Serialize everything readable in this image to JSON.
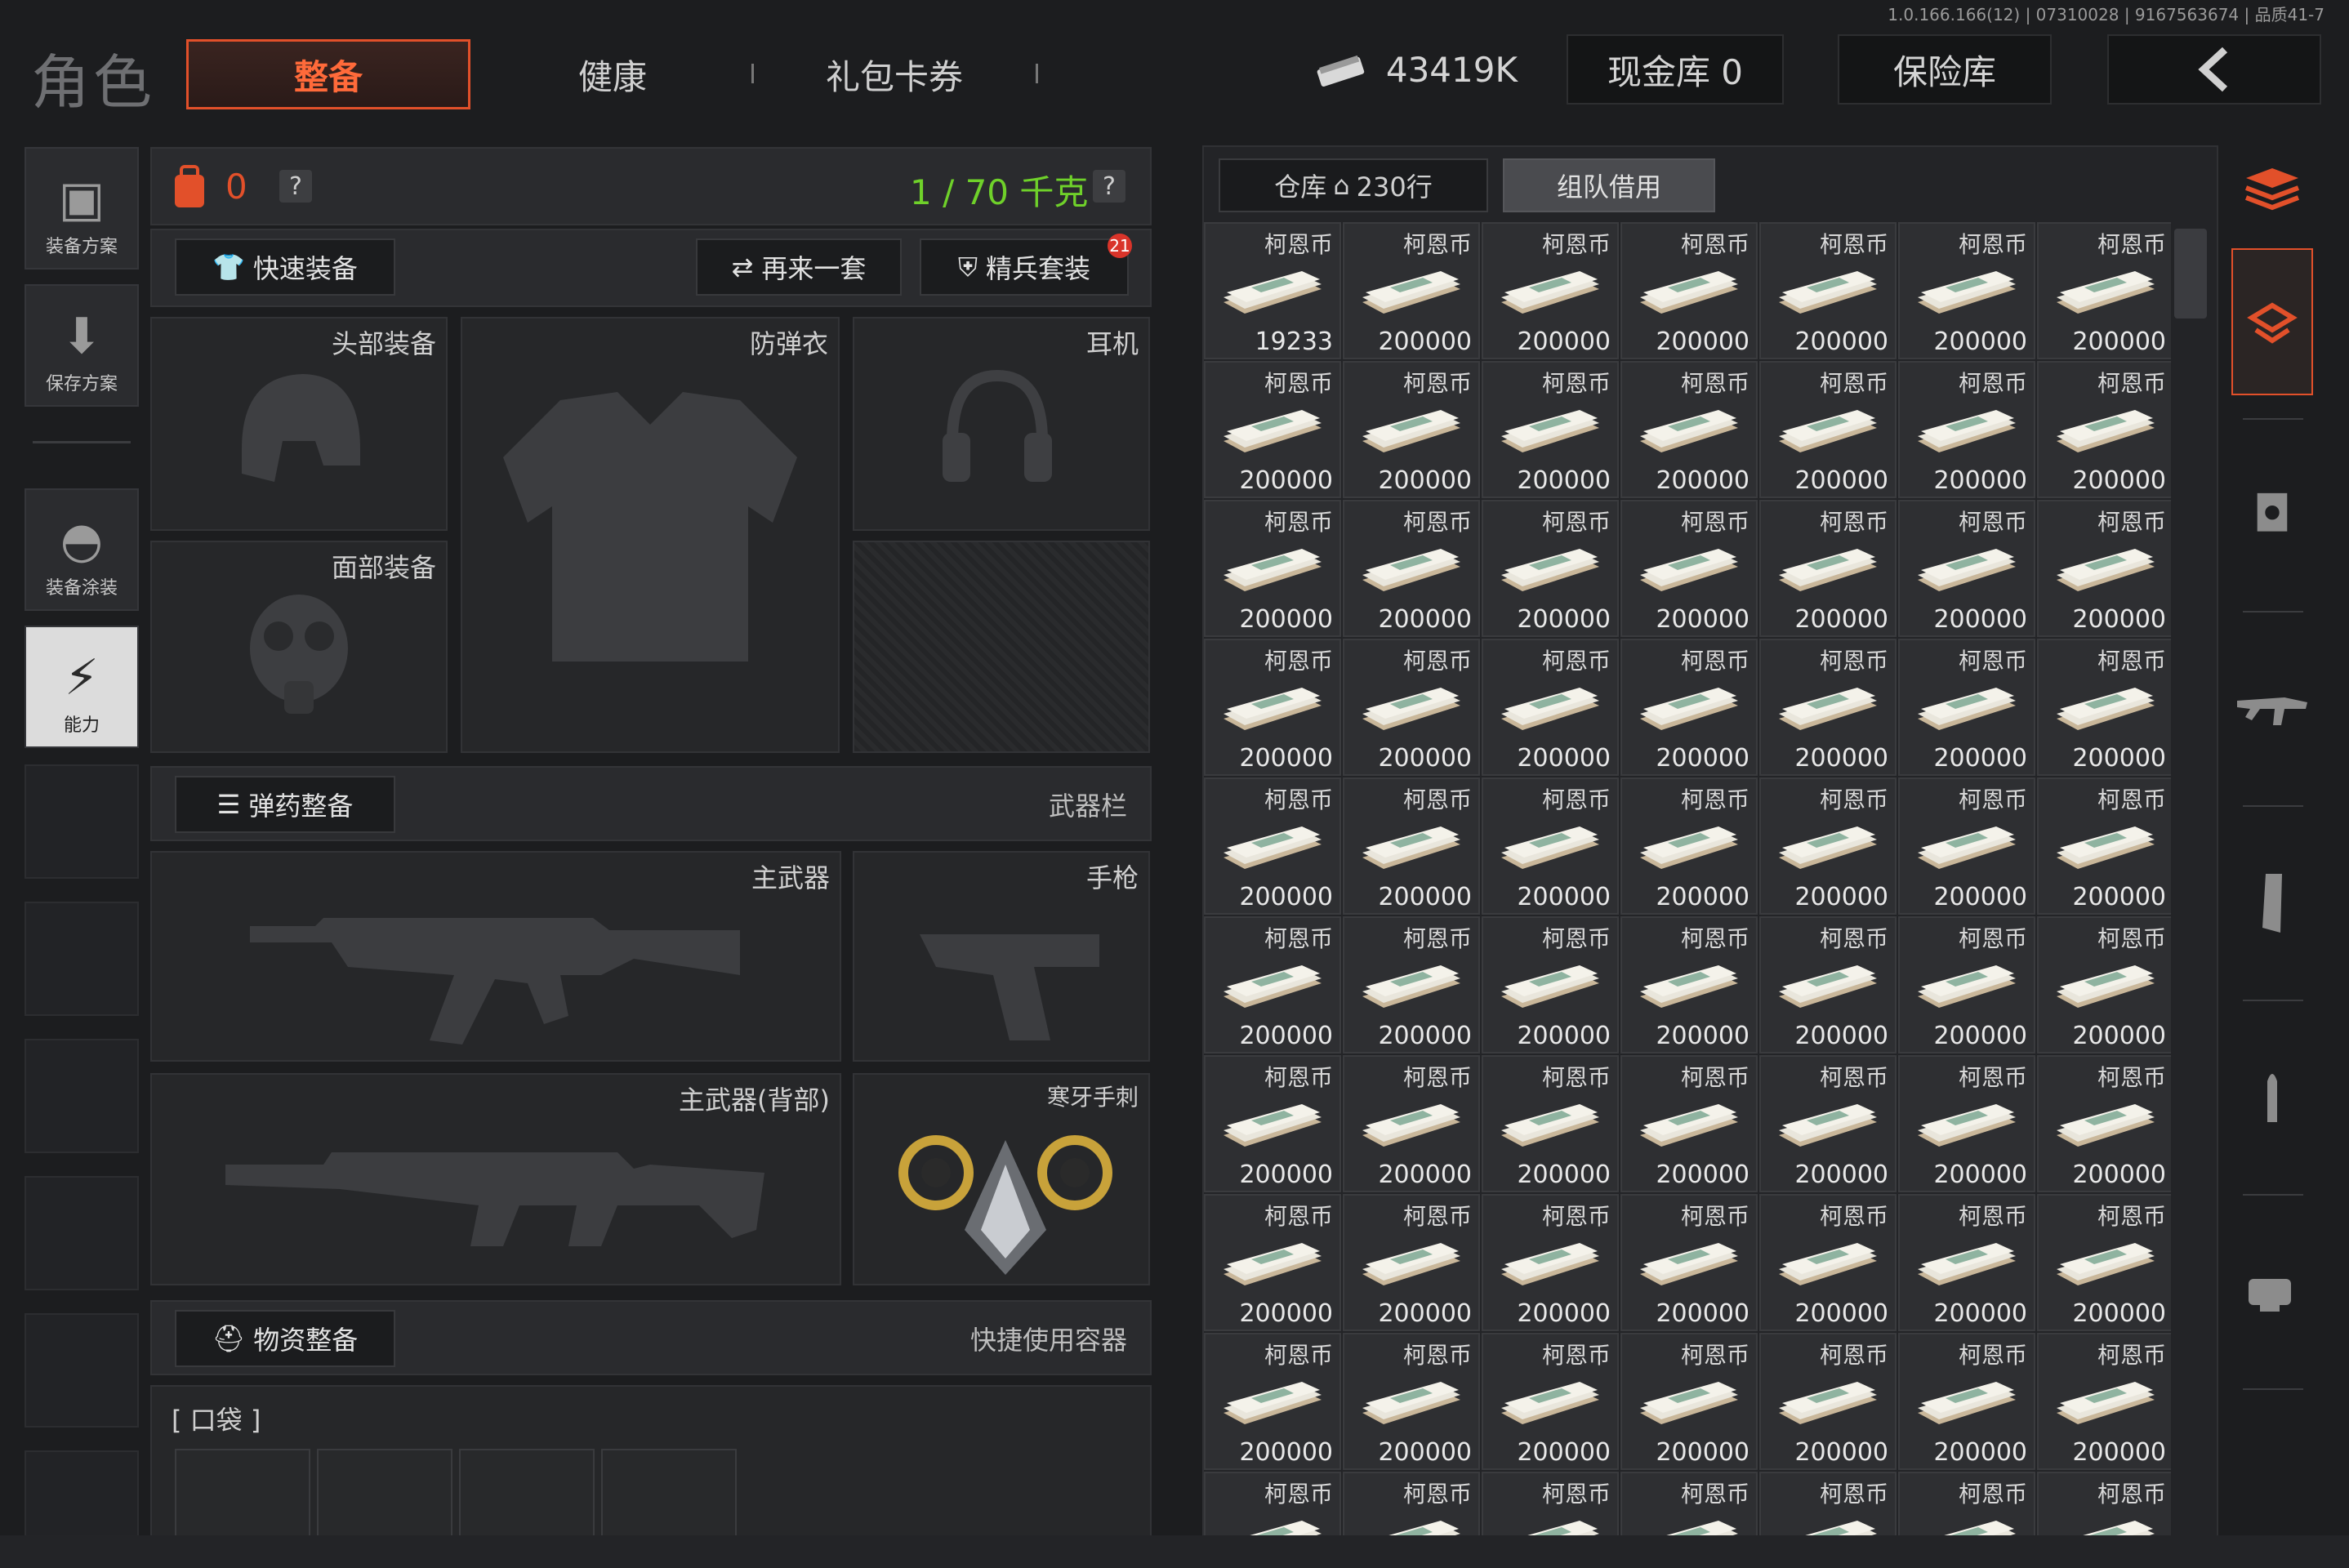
{
  "version": "1.0.166.166(12) | 07310028 | 9167563674 | 品质41-7",
  "page_title": "角色",
  "tabs": {
    "equip": "整备",
    "health": "健康",
    "gift": "礼包卡券"
  },
  "header": {
    "money": "43419K",
    "cash_vault": "现金库 0",
    "safe": "保险库",
    "back_icon": "chevron-left-icon"
  },
  "sidebar": {
    "items": [
      {
        "label": "装备方案",
        "icon": "vest-icon"
      },
      {
        "label": "保存方案",
        "icon": "download-icon"
      },
      {
        "label": "装备涂装",
        "icon": "helmet-paint-icon"
      },
      {
        "label": "能力",
        "icon": "ability-icon"
      }
    ]
  },
  "loadout": {
    "backpack_count": "0",
    "weight": "1 / 70 千克",
    "help": "?",
    "quick_equip": "快速装备",
    "again": "再来一套",
    "elite": "精兵套装",
    "elite_badge": "21",
    "slots": {
      "head": "头部装备",
      "armor": "防弹衣",
      "headset": "耳机",
      "face": "面部装备",
      "primary": "主武器",
      "pistol": "手枪",
      "primary_back": "主武器(背部)",
      "melee": "寒牙手刺"
    },
    "ammo_title": "弹药整备",
    "weapon_bar": "武器栏",
    "supply_title": "物资整备",
    "quick_container": "快捷使用容器",
    "pocket": "[ 口袋 ]"
  },
  "warehouse": {
    "tab_label": "仓库",
    "rows": "230行",
    "team_borrow": "组队借用",
    "item_name": "柯恩币",
    "cells": [
      "19233",
      "200000",
      "200000",
      "200000",
      "200000",
      "200000",
      "200000",
      "200000",
      "200000",
      "200000",
      "200000",
      "200000",
      "200000",
      "200000",
      "200000",
      "200000",
      "200000",
      "200000",
      "200000",
      "200000",
      "200000",
      "200000",
      "200000",
      "200000",
      "200000",
      "200000",
      "200000",
      "200000",
      "200000",
      "200000",
      "200000",
      "200000",
      "200000",
      "200000",
      "200000",
      "200000",
      "200000",
      "200000",
      "200000",
      "200000",
      "200000",
      "200000",
      "200000",
      "200000",
      "200000",
      "200000",
      "200000",
      "200000",
      "200000",
      "200000",
      "200000",
      "200000",
      "200000",
      "200000",
      "200000",
      "200000",
      "200000",
      "200000",
      "200000",
      "200000",
      "200000",
      "200000",
      "200000",
      "",
      "",
      "",
      "",
      "",
      "",
      ""
    ]
  },
  "filters": [
    "all-items-icon",
    "equipment-icon",
    "armor-icon",
    "rifle-icon",
    "magazine-icon",
    "ammo-icon",
    "attachment-icon"
  ],
  "colors": {
    "accent": "#e2502a",
    "weight_green": "#6fd12a"
  }
}
